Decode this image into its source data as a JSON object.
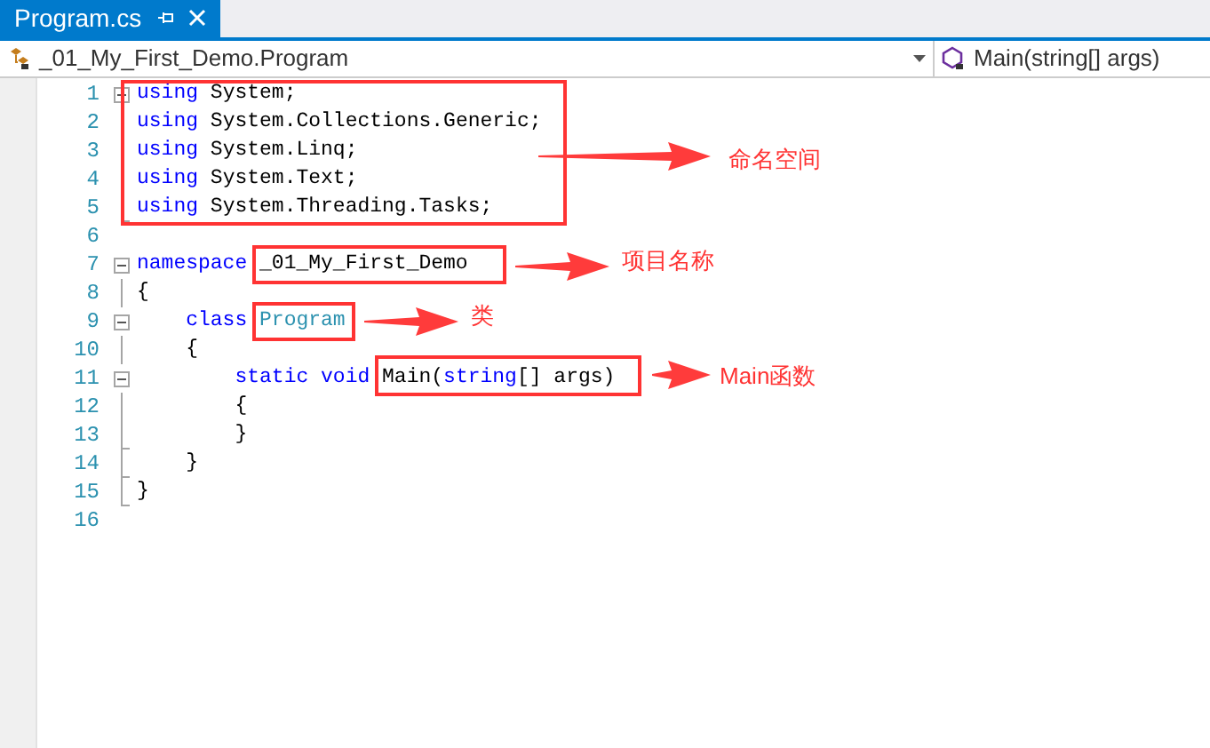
{
  "tabs": [
    {
      "label": "Program.cs",
      "selected": true
    }
  ],
  "navigation": {
    "type_selector": "_01_My_First_Demo.Program",
    "member_selector": "Main(string[] args)"
  },
  "editor": {
    "lines": [
      {
        "number": "1",
        "kind": "start",
        "tokens": [
          {
            "text": "using",
            "kind": "keyword"
          },
          {
            "text": " System;",
            "kind": "plain"
          }
        ]
      },
      {
        "number": "2",
        "kind": "inner",
        "tokens": [
          {
            "text": "using",
            "kind": "keyword"
          },
          {
            "text": " System.Collections.Generic;",
            "kind": "plain"
          }
        ]
      },
      {
        "number": "3",
        "kind": "inner",
        "tokens": [
          {
            "text": "using",
            "kind": "keyword"
          },
          {
            "text": " System.Linq;",
            "kind": "plain"
          }
        ]
      },
      {
        "number": "4",
        "kind": "inner",
        "tokens": [
          {
            "text": "using",
            "kind": "keyword"
          },
          {
            "text": " System.Text;",
            "kind": "plain"
          }
        ]
      },
      {
        "number": "5",
        "kind": "end",
        "tokens": [
          {
            "text": "using",
            "kind": "keyword"
          },
          {
            "text": " System.Threading.Tasks;",
            "kind": "plain"
          }
        ]
      },
      {
        "number": "6",
        "kind": "plain"
      },
      {
        "number": "7",
        "kind": "start",
        "tokens": [
          {
            "text": "namespace ",
            "kind": "keyword"
          },
          {
            "text": "_01_My_First_Demo",
            "kind": "plain",
            "boxed": true
          }
        ]
      },
      {
        "number": "8",
        "kind": "inner",
        "tokens": [
          {
            "text": "{",
            "kind": "plain"
          }
        ]
      },
      {
        "number": "9",
        "kind": "start",
        "tokens": [
          {
            "text": "    class ",
            "kind": "keyword"
          },
          {
            "text": "Program",
            "kind": "type",
            "boxed": true
          }
        ]
      },
      {
        "number": "10",
        "kind": "inner",
        "tokens": [
          {
            "text": "    {",
            "kind": "plain"
          }
        ]
      },
      {
        "number": "11",
        "kind": "start",
        "tokens": [
          {
            "text": "        static void ",
            "kind": "keyword"
          },
          {
            "text": "Main(",
            "kind": "plain"
          },
          {
            "text": "string",
            "kind": "keyword"
          },
          {
            "text": "[] args)",
            "kind": "plain"
          }
        ]
      },
      {
        "number": "12",
        "kind": "inner",
        "tokens": [
          {
            "text": "        {",
            "kind": "plain"
          }
        ]
      },
      {
        "number": "13",
        "kind": "end",
        "tokens": [
          {
            "text": "        }",
            "kind": "plain"
          }
        ]
      },
      {
        "number": "14",
        "kind": "end",
        "tokens": [
          {
            "text": "    }",
            "kind": "plain"
          }
        ]
      },
      {
        "number": "15",
        "kind": "end",
        "tokens": [
          {
            "text": "}",
            "kind": "plain"
          }
        ]
      },
      {
        "number": "16",
        "kind": "plain"
      }
    ]
  },
  "annotations": [
    {
      "label": "命名空间"
    },
    {
      "label": "项目名称"
    },
    {
      "label": "类"
    },
    {
      "label": "Main函数"
    }
  ]
}
